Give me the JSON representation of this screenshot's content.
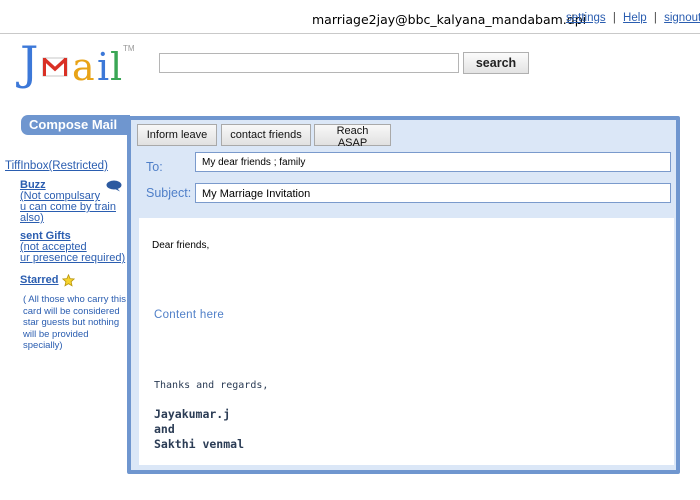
{
  "header": {
    "account_email": "marriage2jay@bbc_kalyana_mandabam.dpi",
    "links": {
      "settings": "settings",
      "help": "Help",
      "signout": "signout",
      "separator": "|"
    }
  },
  "logo": {
    "j": "J",
    "a": "a",
    "i": "i",
    "l": "l",
    "tm": "TM"
  },
  "search": {
    "value": "",
    "placeholder": "",
    "button_label": "search"
  },
  "sidebar": {
    "compose_label": "Compose Mail",
    "inbox_label": "TiffInbox(Restricted)",
    "buzz": {
      "title": "Buzz",
      "lines": [
        "(Not compulsary",
        "u can come by train",
        "also)"
      ]
    },
    "gifts": {
      "title": "sent Gifts",
      "lines": [
        "(not accepted",
        "ur presence required)"
      ]
    },
    "starred": {
      "title": "Starred",
      "note": "( All those who carry this card will be considered star guests but nothing will be provided specially)"
    }
  },
  "compose": {
    "buttons": {
      "inform": "Inform leave",
      "contact": "contact friends",
      "reach": "Reach ASAP"
    },
    "to_label": "To:",
    "to_value": "My dear friends ; family",
    "subject_label": "Subject:",
    "subject_value": "My Marriage Invitation",
    "body": {
      "greeting": "Dear friends,",
      "content": "Content here",
      "thanks": "Thanks and regards,",
      "signature": [
        "Jayakumar.j",
        "and",
        "Sakthi venmal"
      ]
    }
  },
  "colors": {
    "accent_blue": "#6f96cf",
    "link_blue": "#2a5db0",
    "panel_bg": "#dbe7f7",
    "logo_yellow": "#e8a317",
    "logo_green": "#3aa655",
    "logo_red": "#d93025"
  },
  "icons": {
    "chat": "chat-bubble-icon",
    "star": "star-icon",
    "envelope": "envelope-icon"
  }
}
